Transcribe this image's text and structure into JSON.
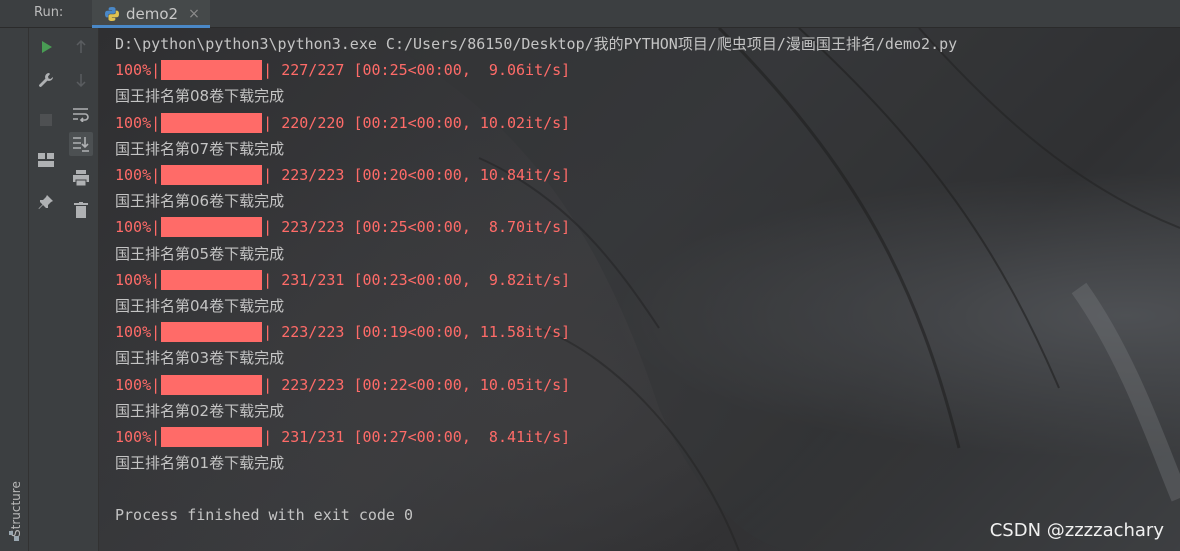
{
  "topbar": {
    "run_label": "Run:",
    "tab_label": "demo2",
    "tab_close": "×"
  },
  "side": {
    "structure_label": "Structure"
  },
  "console": {
    "command": "D:\\python\\python3\\python3.exe C:/Users/86150/Desktop/我的PYTHON项目/爬虫项目/漫画国王排名/demo2.py",
    "entries": [
      {
        "pct": "100%|",
        "stats": "| 227/227 [00:25<00:00,  9.06it/s]",
        "message": "国王排名第08卷下载完成"
      },
      {
        "pct": "100%|",
        "stats": "| 220/220 [00:21<00:00, 10.02it/s]",
        "message": "国王排名第07卷下载完成"
      },
      {
        "pct": "100%|",
        "stats": "| 223/223 [00:20<00:00, 10.84it/s]",
        "message": "国王排名第06卷下载完成"
      },
      {
        "pct": "100%|",
        "stats": "| 223/223 [00:25<00:00,  8.70it/s]",
        "message": "国王排名第05卷下载完成"
      },
      {
        "pct": "100%|",
        "stats": "| 231/231 [00:23<00:00,  9.82it/s]",
        "message": "国王排名第04卷下载完成"
      },
      {
        "pct": "100%|",
        "stats": "| 223/223 [00:19<00:00, 11.58it/s]",
        "message": "国王排名第03卷下载完成"
      },
      {
        "pct": "100%|",
        "stats": "| 223/223 [00:22<00:00, 10.05it/s]",
        "message": "国王排名第02卷下载完成"
      },
      {
        "pct": "100%|",
        "stats": "| 231/231 [00:27<00:00,  8.41it/s]",
        "message": "国王排名第01卷下载完成"
      }
    ],
    "finish": "Process finished with exit code 0"
  },
  "watermark": "CSDN @zzzzachary",
  "colors": {
    "progress": "#ff6b68",
    "text": "#c4c4c4",
    "run_green": "#499c54",
    "tab_underline": "#4a88c7"
  }
}
